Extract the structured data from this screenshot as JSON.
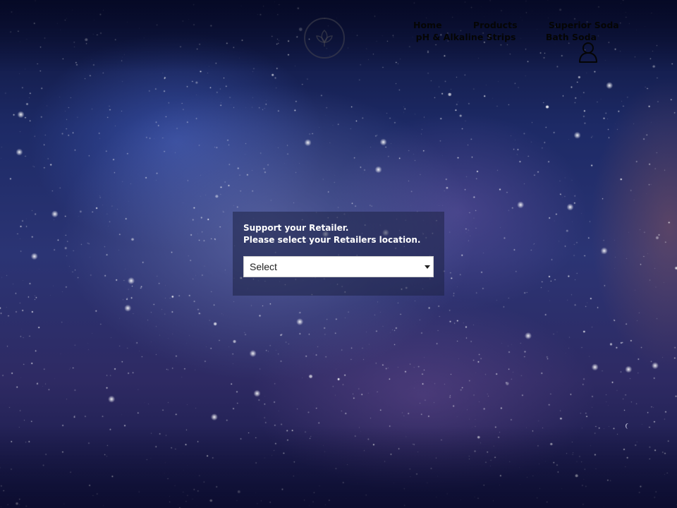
{
  "nav": {
    "items": [
      {
        "label": "Home"
      },
      {
        "label": "Products"
      },
      {
        "label": "Superior Soda"
      },
      {
        "label": "pH & Alkaline Strips"
      },
      {
        "label": "Bath Soda"
      }
    ]
  },
  "panel": {
    "line1": "Support your Retailer.",
    "line2": "Please select your Retailers location.",
    "select": {
      "value": "Select"
    }
  },
  "icons": {
    "logo": "leaf-logo-icon",
    "account": "user-account-icon"
  },
  "colors": {
    "nav_text": "#050505",
    "panel_text": "#ffffff",
    "sky_dark": "#0c1236",
    "sky_mid": "#2b3474"
  }
}
